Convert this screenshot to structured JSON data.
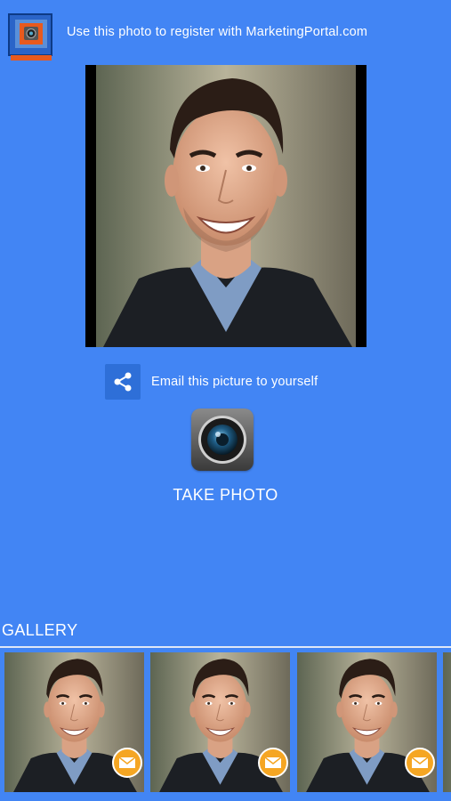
{
  "header": {
    "logo_icon": "marketing-portal-logo",
    "text": "Use this photo to register with MarketingPortal.com"
  },
  "photo": {
    "alt": "Portrait photo"
  },
  "email_action": {
    "icon": "share-icon",
    "label": "Email this picture to yourself"
  },
  "camera": {
    "icon": "camera-lens-icon",
    "label": "TAKE PHOTO"
  },
  "gallery": {
    "title": "GALLERY",
    "items": [
      {
        "badge_icon": "mail-icon"
      },
      {
        "badge_icon": "mail-icon"
      },
      {
        "badge_icon": "mail-icon"
      }
    ]
  },
  "colors": {
    "background": "#4285f4",
    "badge": "#f5a623",
    "share_button": "#2e6fd8"
  }
}
